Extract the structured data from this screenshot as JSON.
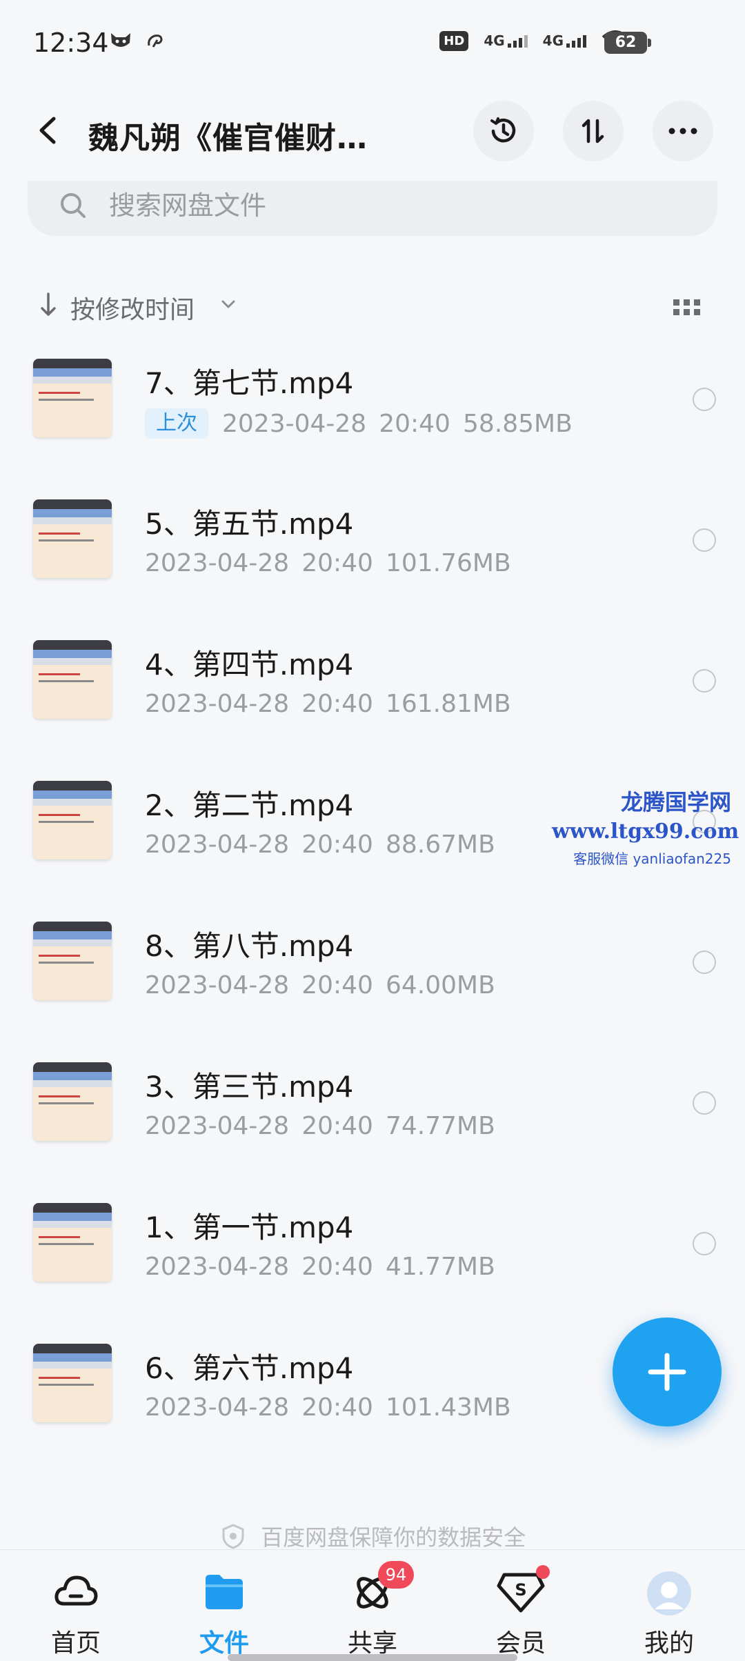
{
  "status_bar": {
    "time": "12:34",
    "hd": "HD",
    "net1": "4G",
    "net2": "4G",
    "battery": "62"
  },
  "header": {
    "title": "魏凡朔《催官催财…"
  },
  "search": {
    "placeholder": "搜索网盘文件"
  },
  "sort": {
    "label": "按修改时间"
  },
  "files": [
    {
      "name": "7、第七节.mp4",
      "badge": "上次",
      "date": "2023-04-28",
      "time": "20:40",
      "size": "58.85MB"
    },
    {
      "name": "5、第五节.mp4",
      "badge": "",
      "date": "2023-04-28",
      "time": "20:40",
      "size": "101.76MB"
    },
    {
      "name": "4、第四节.mp4",
      "badge": "",
      "date": "2023-04-28",
      "time": "20:40",
      "size": "161.81MB"
    },
    {
      "name": "2、第二节.mp4",
      "badge": "",
      "date": "2023-04-28",
      "time": "20:40",
      "size": "88.67MB"
    },
    {
      "name": "8、第八节.mp4",
      "badge": "",
      "date": "2023-04-28",
      "time": "20:40",
      "size": "64.00MB"
    },
    {
      "name": "3、第三节.mp4",
      "badge": "",
      "date": "2023-04-28",
      "time": "20:40",
      "size": "74.77MB"
    },
    {
      "name": "1、第一节.mp4",
      "badge": "",
      "date": "2023-04-28",
      "time": "20:40",
      "size": "41.77MB"
    },
    {
      "name": "6、第六节.mp4",
      "badge": "",
      "date": "2023-04-28",
      "time": "20:40",
      "size": "101.43MB"
    }
  ],
  "watermark": {
    "line1": "龙腾国学网",
    "line2": "www.ltgx99.com",
    "line3": "客服微信 yanliaofan225"
  },
  "security_note": "百度网盘保障你的数据安全",
  "bottom_nav": {
    "home": "首页",
    "files": "文件",
    "share": "共享",
    "share_badge": "94",
    "vip": "会员",
    "mine": "我的"
  },
  "colors": {
    "accent": "#1fa3f0",
    "badge_red": "#f04a5a"
  }
}
